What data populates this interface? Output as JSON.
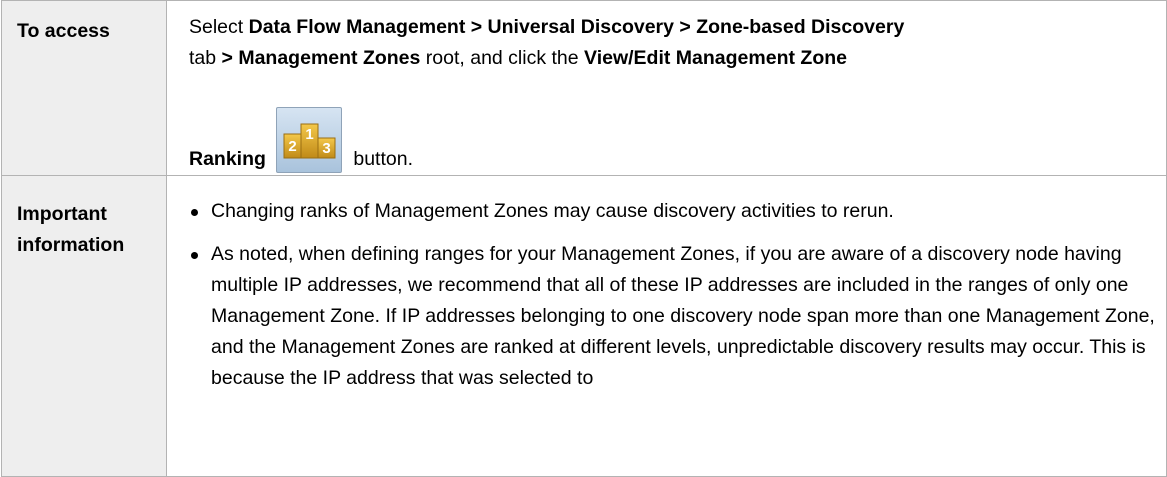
{
  "rows": [
    {
      "label": "To access",
      "parts": {
        "p1": "Select ",
        "b1": "Data Flow Management > Universal Discovery > Zone-based Discovery",
        "p2": " tab ",
        "b2": "> Management Zones",
        "p3": " root, and click the ",
        "b3": "View/Edit Management Zone",
        "b4": "Ranking",
        "p4": " button."
      },
      "icon": "ranking-podium-icon"
    },
    {
      "label_line1": "Important",
      "label_line2": "information",
      "bullets": [
        "Changing ranks of Management Zones may cause discovery activities to rerun.",
        "As noted, when defining ranges for your Management Zones, if you are aware of a discovery node having multiple IP addresses, we recommend that all of these IP addresses are included in the ranges of only one Management Zone. If IP addresses belonging to one discovery node span more than one Management Zone, and the Management Zones are ranked at different levels, unpredictable discovery results may occur. This is because the IP address that was selected to"
      ]
    }
  ],
  "colors": {
    "label_bg": "#eeeeee",
    "border": "#b3b3b3",
    "icon_gold": "#d9a52a"
  }
}
